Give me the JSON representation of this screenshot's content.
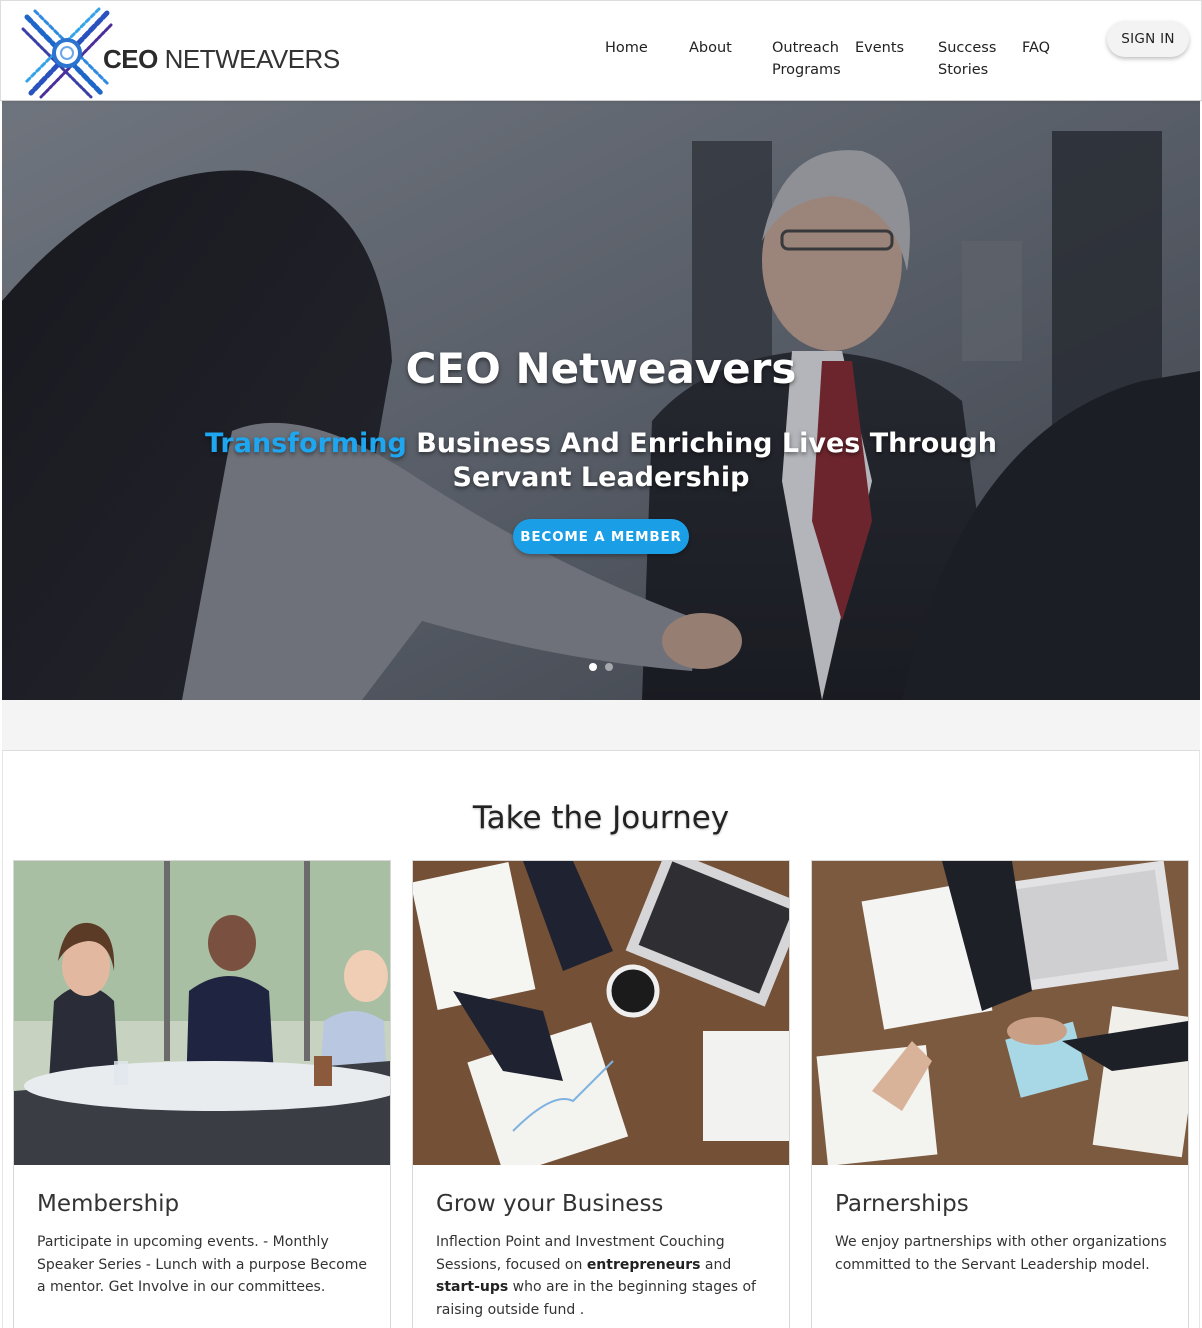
{
  "brand": {
    "name_bold": "CEO",
    "name_light": " NETWEAVERS"
  },
  "nav": {
    "items": [
      {
        "label": "Home"
      },
      {
        "label": "About"
      },
      {
        "label": "Outreach\nPrograms"
      },
      {
        "label": "Events"
      },
      {
        "label": "Success\nStories"
      },
      {
        "label": "FAQ"
      }
    ],
    "signin_label": "SIGN IN"
  },
  "hero": {
    "title": "CEO Netweavers",
    "subtitle_accent": "Transforming",
    "subtitle_rest": " Business And Enriching Lives Through Servant Leadership",
    "cta_label": "BECOME A MEMBER",
    "slides_count": 2,
    "active_slide": 1,
    "accent_color": "#1ea7f0"
  },
  "journey": {
    "title": "Take the Journey",
    "cards": [
      {
        "title": "Membership",
        "text": "Participate in upcoming events. - Monthly Speaker Series - Lunch with a purpose Become a mentor. Get Involve in our committees."
      },
      {
        "title": "Grow your Business",
        "text_part1": "Inflection Point and Investment Couching Sessions, focused on ",
        "text_bold1": "entrepreneurs",
        "text_part2": " and ",
        "text_bold2": "start-ups",
        "text_part3": " who are in the beginning stages of raising outside fund ."
      },
      {
        "title": "Parnerships",
        "text": "We enjoy partnerships with other organizations committed to the Servant Leadership model."
      }
    ]
  }
}
